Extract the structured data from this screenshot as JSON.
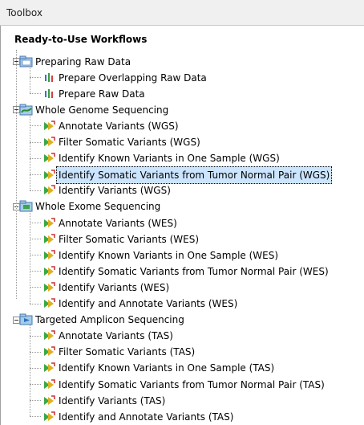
{
  "toolbox": {
    "title": "Toolbox"
  },
  "tree": {
    "root": "Ready-to-Use Workflows",
    "groups": [
      {
        "label": "Preparing Raw Data",
        "items": [
          "Prepare Overlapping Raw Data",
          "Prepare Raw Data"
        ]
      },
      {
        "label": "Whole Genome Sequencing",
        "items": [
          "Annotate Variants (WGS)",
          "Filter Somatic Variants (WGS)",
          "Identify Known Variants in One Sample (WGS)",
          "Identify Somatic Variants from Tumor Normal Pair (WGS)",
          "Identify Variants (WGS)"
        ]
      },
      {
        "label": "Whole Exome Sequencing",
        "items": [
          "Annotate Variants (WES)",
          "Filter Somatic Variants (WES)",
          "Identify Known Variants in One Sample (WES)",
          "Identify Somatic Variants from Tumor Normal Pair (WES)",
          "Identify Variants (WES)",
          "Identify and Annotate Variants (WES)"
        ]
      },
      {
        "label": "Targeted Amplicon Sequencing",
        "items": [
          "Annotate Variants (TAS)",
          "Filter Somatic Variants (TAS)",
          "Identify Known Variants in One Sample (TAS)",
          "Identify Somatic Variants from Tumor Normal Pair (TAS)",
          "Identify Variants (TAS)",
          "Identify and Annotate Variants (TAS)"
        ]
      }
    ],
    "selected_item": "Identify Somatic Variants from Tumor Normal Pair (WGS)"
  }
}
